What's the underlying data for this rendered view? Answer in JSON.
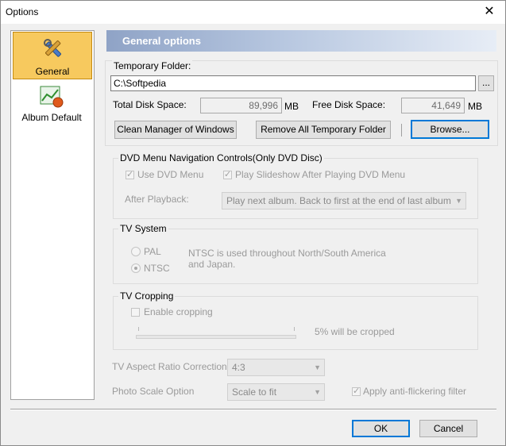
{
  "window": {
    "title": "Options",
    "close_glyph": "✕"
  },
  "sidebar": {
    "items": [
      {
        "label": "General",
        "icon": "tools-icon",
        "selected": true
      },
      {
        "label": "Album Default",
        "icon": "chart-icon",
        "selected": false
      }
    ]
  },
  "header": {
    "title": "General options"
  },
  "temp_folder": {
    "group_label": "Temporary Folder:",
    "path_value": "C:\\Softpedia",
    "browse_small_label": "...",
    "total_disk_label": "Total Disk Space:",
    "total_disk_value": "89,996",
    "total_unit": "MB",
    "free_disk_label": "Free Disk Space:",
    "free_disk_value": "41,649",
    "free_unit": "MB",
    "clean_button": "Clean Manager of Windows",
    "remove_button": "Remove All Temporary Folder",
    "browse_button": "Browse..."
  },
  "dvd_menu": {
    "group_label": "DVD Menu Navigation Controls(Only DVD Disc)",
    "use_dvd_menu": "Use DVD Menu",
    "play_slideshow": "Play Slideshow After Playing DVD Menu",
    "after_playback_label": "After Playback:",
    "after_playback_value": "Play next album. Back to first at the end of last album"
  },
  "tv_system": {
    "group_label": "TV System",
    "pal": "PAL",
    "ntsc": "NTSC",
    "note": "NTSC is used throughout North/South America and Japan."
  },
  "tv_cropping": {
    "group_label": "TV Cropping",
    "enable": "Enable cropping",
    "crop_text": "5% will be cropped",
    "slider_value_percent": 5
  },
  "bottom": {
    "aspect_label": "TV Aspect Ratio Correction",
    "aspect_value": "4:3",
    "photo_scale_label": "Photo Scale Option",
    "photo_scale_value": "Scale to fit",
    "anti_flicker": "Apply anti-flickering filter"
  },
  "footer": {
    "ok": "OK",
    "cancel": "Cancel"
  }
}
